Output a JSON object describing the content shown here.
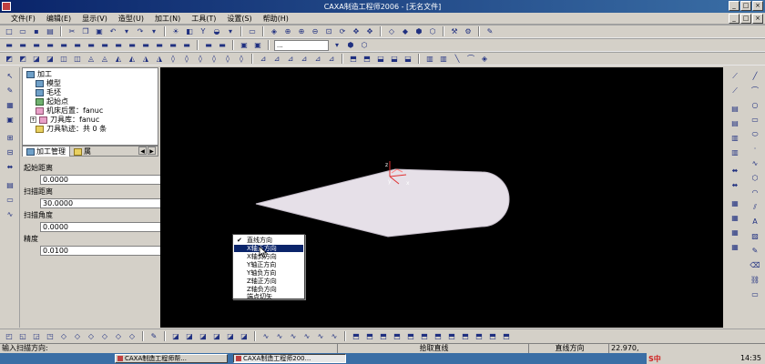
{
  "window": {
    "title": "CAXA制造工程师2006 - [无名文件]",
    "controls": [
      "_",
      "□",
      "×"
    ]
  },
  "menu": [
    "文件(F)",
    "编辑(E)",
    "显示(V)",
    "造型(U)",
    "加工(N)",
    "工具(T)",
    "设置(S)",
    "帮助(H)"
  ],
  "mdi_controls": [
    "_",
    "□",
    "×"
  ],
  "toolbar": {
    "combo_value": "..."
  },
  "tree": {
    "root": "加工",
    "items": [
      "模型",
      "毛坯",
      "起始点",
      "机床后置：fanuc",
      "刀具库：fanuc",
      "刀具轨迹：共 0 条"
    ]
  },
  "tabs": {
    "active": "加工管理",
    "second": "属"
  },
  "params": [
    {
      "label": "起始距离",
      "value": "0.0000"
    },
    {
      "label": "扫描距离",
      "value": "30.0000"
    },
    {
      "label": "扫描角度",
      "value": "0.0000"
    },
    {
      "label": "精度",
      "value": "0.0100"
    }
  ],
  "viewport": {
    "axes": {
      "z": "z",
      "x": "x",
      "y": "y"
    }
  },
  "context_menu": {
    "items": [
      "直线方向",
      "X轴正方向",
      "X轴负方向",
      "Y轴正方向",
      "Y轴负方向",
      "Z轴正方向",
      "Z轴负方向",
      "端点切矢"
    ],
    "checked_index": 0,
    "highlighted_index": 1
  },
  "status": {
    "prompt": "输入扫描方向:",
    "pick": "拾取直线",
    "mode": "直线方向",
    "coords": "22.970,"
  },
  "taskbar": {
    "tasks": [
      "CAXA制造工程师帮...",
      "CAXA制造工程师200..."
    ],
    "active_index": 1,
    "ime": "S中",
    "clock": "14:35"
  },
  "colors": {
    "title_start": "#0a246a",
    "viewport_bg": "#000000",
    "surface_fill": "#e6e0e8",
    "highlight": "#0a246a"
  }
}
